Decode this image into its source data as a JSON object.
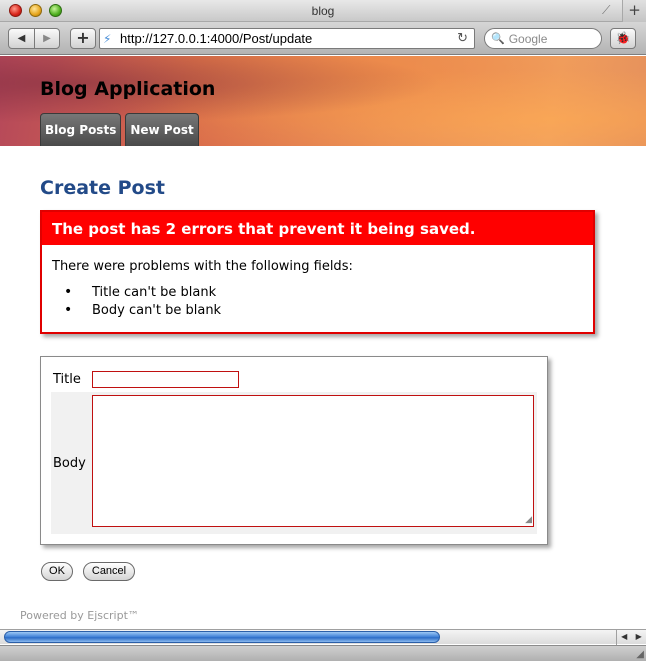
{
  "window": {
    "title": "blog"
  },
  "toolbar": {
    "back_label": "◀",
    "forward_label": "▶",
    "add_label": "+",
    "url": "http://127.0.0.1:4000/Post/update",
    "search_placeholder": "Google"
  },
  "header": {
    "app_title": "Blog Application",
    "nav": [
      {
        "label": "Blog Posts"
      },
      {
        "label": "New Post"
      }
    ]
  },
  "main": {
    "heading": "Create Post",
    "errors": {
      "title": "The post has 2 errors that prevent it being saved.",
      "intro": "There were problems with the following fields:",
      "items": [
        "Title can't be blank",
        "Body can't be blank"
      ]
    },
    "form": {
      "title_label": "Title",
      "title_value": "",
      "body_label": "Body",
      "body_value": ""
    },
    "buttons": {
      "ok": "OK",
      "cancel": "Cancel"
    }
  },
  "footer": {
    "powered_by": "Powered by Ejscript™"
  },
  "colors": {
    "heading": "#224a88",
    "error": "#ff0000"
  }
}
